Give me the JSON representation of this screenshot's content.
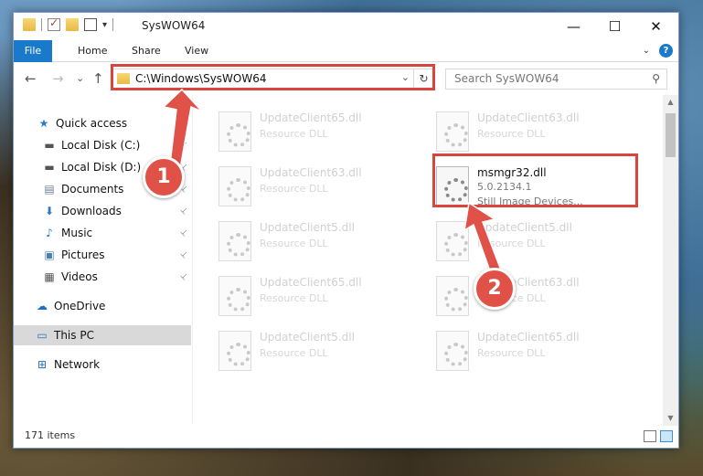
{
  "window": {
    "title": "SysWOW64",
    "minimize_glyph": "—",
    "maximize_glyph": "☐",
    "close_glyph": "✕",
    "qa_dropdown_glyph": "▾"
  },
  "ribbon": {
    "tabs": [
      "File",
      "Home",
      "Share",
      "View"
    ],
    "expand_glyph": "⌄",
    "help_glyph": "?"
  },
  "nav": {
    "back_glyph": "←",
    "forward_glyph": "→",
    "recent_glyph": "⌄",
    "up_glyph": "↑",
    "address": "C:\\Windows\\SysWOW64",
    "address_dropdown_glyph": "⌄",
    "refresh_glyph": "↻",
    "search_placeholder": "Search SysWOW64",
    "search_glyph": "⚲"
  },
  "sidebar": {
    "items": [
      {
        "label": "Quick access",
        "icon": "star-icon",
        "glyph": "★",
        "pinned": false
      },
      {
        "label": "Local Disk (C:)",
        "icon": "drive-icon",
        "glyph": "▬",
        "pinned": true
      },
      {
        "label": "Local Disk (D:)",
        "icon": "drive-icon",
        "glyph": "▬",
        "pinned": true
      },
      {
        "label": "Documents",
        "icon": "documents-icon",
        "glyph": "▤",
        "pinned": true
      },
      {
        "label": "Downloads",
        "icon": "download-icon",
        "glyph": "⬇",
        "pinned": true
      },
      {
        "label": "Music",
        "icon": "music-icon",
        "glyph": "♪",
        "pinned": true
      },
      {
        "label": "Pictures",
        "icon": "pictures-icon",
        "glyph": "▣",
        "pinned": true
      },
      {
        "label": "Videos",
        "icon": "videos-icon",
        "glyph": "▦",
        "pinned": true
      },
      {
        "label": "OneDrive",
        "icon": "cloud-icon",
        "glyph": "☁",
        "pinned": false
      },
      {
        "label": "This PC",
        "icon": "computer-icon",
        "glyph": "▭",
        "pinned": false
      },
      {
        "label": "Network",
        "icon": "network-icon",
        "glyph": "⊞",
        "pinned": false
      }
    ],
    "pin_glyph": "📌"
  },
  "files": [
    {
      "name": "UpdateClient65.dll",
      "type": "Resource DLL"
    },
    {
      "name": "UpdateClient63.dll",
      "type": "Resource DLL"
    },
    {
      "name": "UpdateClient63.dll",
      "type": "Resource DLL"
    },
    {
      "name": "msmgr32.dll",
      "version": "5.0.2134.1",
      "description": "Still Image Devices..."
    },
    {
      "name": "UpdateClient5.dll",
      "type": "Resource DLL"
    },
    {
      "name": "UpdateClient5.dll",
      "type": "Resource DLL"
    },
    {
      "name": "UpdateClient65.dll",
      "type": "Resource DLL"
    },
    {
      "name": "UpdateClient63.dll",
      "type": "Resource DLL"
    },
    {
      "name": "UpdateClient5.dll",
      "type": "Resource DLL"
    },
    {
      "name": "UpdateClient65.dll",
      "type": "Resource DLL"
    }
  ],
  "status": {
    "item_count": "171 items"
  },
  "annotations": {
    "step1": "1",
    "step2": "2",
    "color": "#e05147"
  }
}
